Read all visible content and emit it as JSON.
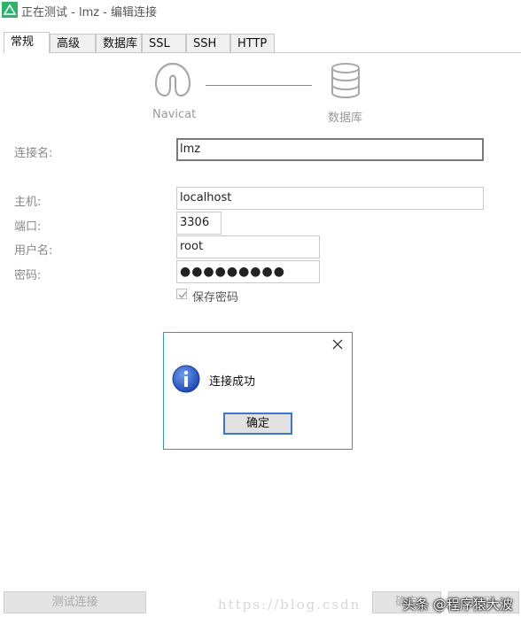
{
  "window": {
    "title": "正在测试 - lmz - 编辑连接"
  },
  "tabs": [
    {
      "label": "常规",
      "active": true
    },
    {
      "label": "高级"
    },
    {
      "label": "数据库"
    },
    {
      "label": "SSL"
    },
    {
      "label": "SSH"
    },
    {
      "label": "HTTP"
    }
  ],
  "diagram": {
    "left_label": "Navicat",
    "right_label": "数据库"
  },
  "form": {
    "conn_name": {
      "label": "连接名:",
      "value": "lmz"
    },
    "host": {
      "label": "主机:",
      "value": "localhost"
    },
    "port": {
      "label": "端口:",
      "value": "3306"
    },
    "user": {
      "label": "用户名:",
      "value": "root"
    },
    "password": {
      "label": "密码:",
      "value": "●●●●●●●●●"
    },
    "save_password": {
      "label": "保存密码",
      "checked": true
    }
  },
  "dialog": {
    "message": "连接成功",
    "ok_label": "确定"
  },
  "bottom": {
    "test_label": "测试连接",
    "ok_label": "确定",
    "cancel_label": "取消"
  },
  "watermark": {
    "url": "https://blog.csdn",
    "overlay": "头条 @程序猿大波"
  },
  "colors": {
    "accent": "#3b78c9",
    "dialog_border": "#3b9a94",
    "info_icon": "#2b59c3",
    "logo_green": "#2db36b"
  }
}
